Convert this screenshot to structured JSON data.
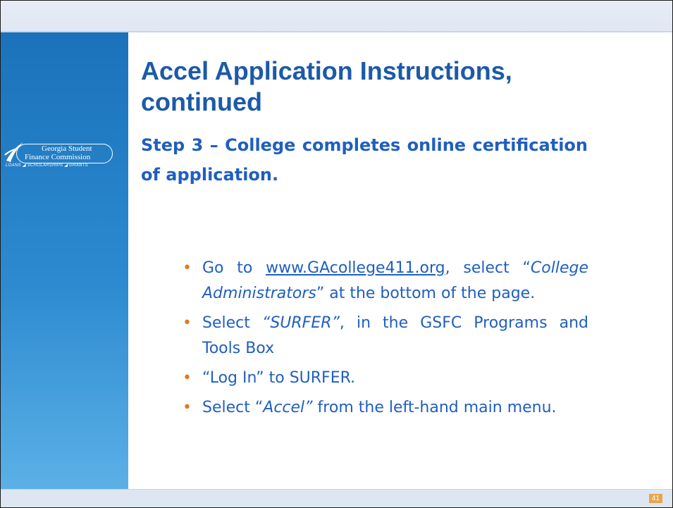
{
  "slide": {
    "title": "Accel Application Instructions, continued",
    "step_text": "Step 3 – College completes online certification of application.",
    "slide_number": "41"
  },
  "logo": {
    "line1": "Georgia Student",
    "line2": "Finance Commission",
    "tagline": "LOANS ◢ SCHOLARSHIPS ◢ GRANTS"
  },
  "bullets": {
    "b1": {
      "p1": "Go to ",
      "link": "www.GAcollege411.org",
      "p2": ", select “",
      "em": "College Administrators",
      "p3": "” at the bottom of the page."
    },
    "b2": {
      "p1": "Select ",
      "em": "“SURFER”",
      "p2": ", in the GSFC Programs and Tools Box"
    },
    "b3": {
      "p1": "“Log In” to SURFER."
    },
    "b4": {
      "p1": "Select “",
      "em": "Accel”",
      "p2": " from the left-hand main menu."
    }
  },
  "colors": {
    "title": "#1c5aa8",
    "body_text": "#1f5fbf",
    "bullet": "#e07b21",
    "side_panel": "#2d8ad0"
  }
}
